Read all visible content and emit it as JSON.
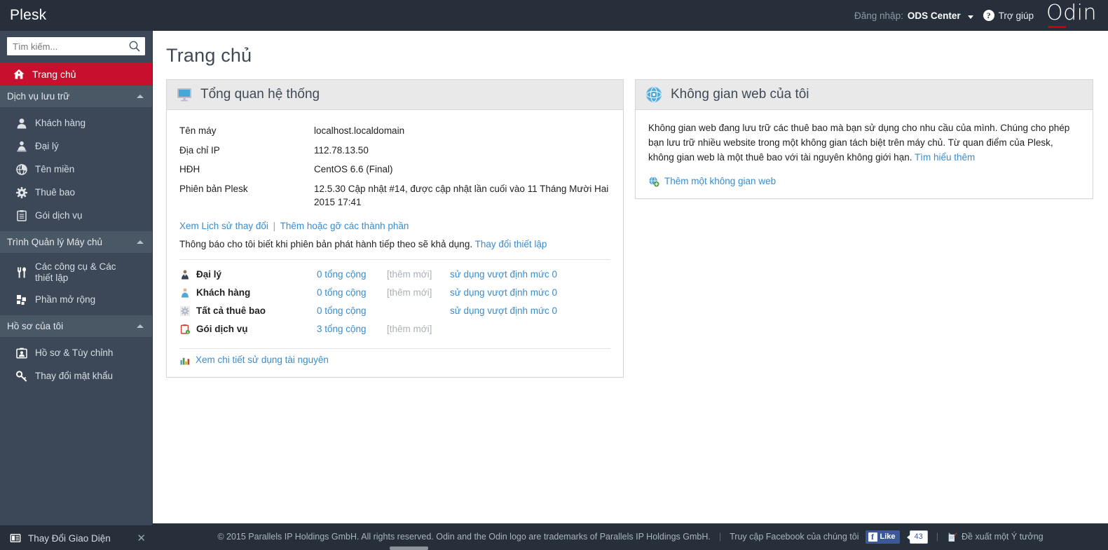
{
  "topbar": {
    "brand": "Plesk",
    "login_label": "Đăng nhập:",
    "login_user": "ODS Center",
    "help_icon": "question-mark-circle-icon",
    "help_text": "Trợ giúp",
    "logo": "Odin"
  },
  "sidebar": {
    "search_placeholder": "Tìm kiếm...",
    "search_value": "",
    "search_icon": "search-icon",
    "home": {
      "label": "Trang chủ",
      "icon": "home-icon",
      "active": true
    },
    "sections": [
      {
        "label": "Dịch vụ lưu trữ",
        "icon": "chevron-up-icon",
        "items": [
          {
            "label": "Khách hàng",
            "icon": "user-icon"
          },
          {
            "label": "Đại lý",
            "icon": "reseller-icon"
          },
          {
            "label": "Tên miền",
            "icon": "globe-icon"
          },
          {
            "label": "Thuê bao",
            "icon": "gear-icon"
          },
          {
            "label": "Gói dịch vụ",
            "icon": "clipboard-icon"
          }
        ]
      },
      {
        "label": "Trình Quản lý Máy chủ",
        "icon": "chevron-up-icon",
        "items": [
          {
            "label": "Các công cụ & Các thiết lập",
            "icon": "tools-icon",
            "two_line": true
          },
          {
            "label": "Phần mở rộng",
            "icon": "extensions-icon"
          }
        ]
      },
      {
        "label": "Hồ sơ của tôi",
        "icon": "chevron-up-icon",
        "items": [
          {
            "label": "Hồ sơ & Tùy chỉnh",
            "icon": "profile-card-icon"
          },
          {
            "label": "Thay đổi mật khẩu",
            "icon": "key-icon"
          }
        ]
      }
    ],
    "theme_switch": {
      "label": "Thay Đổi Giao Diện",
      "icon": "layout-icon",
      "close_icon": "close-icon"
    }
  },
  "main": {
    "page_title": "Trang chủ",
    "system_overview": {
      "title": "Tổng quan hệ thống",
      "icon": "monitor-icon",
      "rows": [
        {
          "key": "Tên máy",
          "value": "localhost.localdomain"
        },
        {
          "key": "Địa chỉ IP",
          "value": "112.78.13.50"
        },
        {
          "key": "HĐH",
          "value": "CentOS 6.6 (Final)"
        },
        {
          "key": "Phiên bản Plesk",
          "value": "12.5.30 Cập nhật #14, được cập nhật lần cuối vào 11 Tháng Mười Hai 2015 17:41"
        }
      ],
      "links": [
        {
          "label": "Xem Lịch sử thay đổi"
        },
        {
          "label": "Thêm hoặc gỡ các thành phần"
        }
      ],
      "notice_text": "Thông báo cho tôi biết khi phiên bản phát hành tiếp theo sẽ khả dụng.",
      "notice_link": "Thay đổi thiết lập",
      "stats": [
        {
          "name": "Đại lý",
          "icon": "reseller-icon",
          "total": "0 tổng cộng",
          "add": "[thêm mới]",
          "over": "sử dụng vượt định mức 0"
        },
        {
          "name": "Khách hàng",
          "icon": "customer-icon",
          "total": "0 tổng cộng",
          "add": "[thêm mới]",
          "over": "sử dụng vượt định mức 0"
        },
        {
          "name": "Tất cả thuê bao",
          "icon": "gear-icon",
          "total": "0 tổng cộng",
          "add": "",
          "over": "sử dụng vượt định mức 0"
        },
        {
          "name": "Gói dịch vụ",
          "icon": "clipboard-icon",
          "total": "3 tổng cộng",
          "add": "[thêm mới]",
          "over": ""
        }
      ],
      "resource_link": "Xem chi tiết sử dụng tài nguyên",
      "resource_icon": "bar-chart-icon"
    },
    "webspaces": {
      "title": "Không gian web của tôi",
      "icon": "globe-sphere-icon",
      "description": "Không gian web đang lưu trữ các thuê bao mà bạn sử dụng cho nhu cầu của mình. Chúng cho phép bạn lưu trữ nhiều website trong một không gian tách biệt trên máy chủ. Từ quan điểm của Plesk, không gian web là một thuê bao với tài nguyên không giới hạn.",
      "learn_more": "Tìm hiểu thêm",
      "add_link": "Thêm một không gian web",
      "add_icon": "add-webspace-icon"
    }
  },
  "footer": {
    "copyright": "© 2015 Parallels IP Holdings GmbH. All rights reserved. Odin and the Odin logo are trademarks of Parallels IP Holdings GmbH.",
    "facebook_text": "Truy cập Facebook của chúng tôi",
    "like_label": "Like",
    "like_count": "43",
    "idea_label": "Đề xuất một Ý tưởng",
    "idea_icon": "pencil-note-icon"
  },
  "colors": {
    "accent_red": "#c8102e",
    "sidebar_bg": "#3c4857",
    "topbar_bg": "#262f3a",
    "link_blue": "#3a8ccc"
  }
}
